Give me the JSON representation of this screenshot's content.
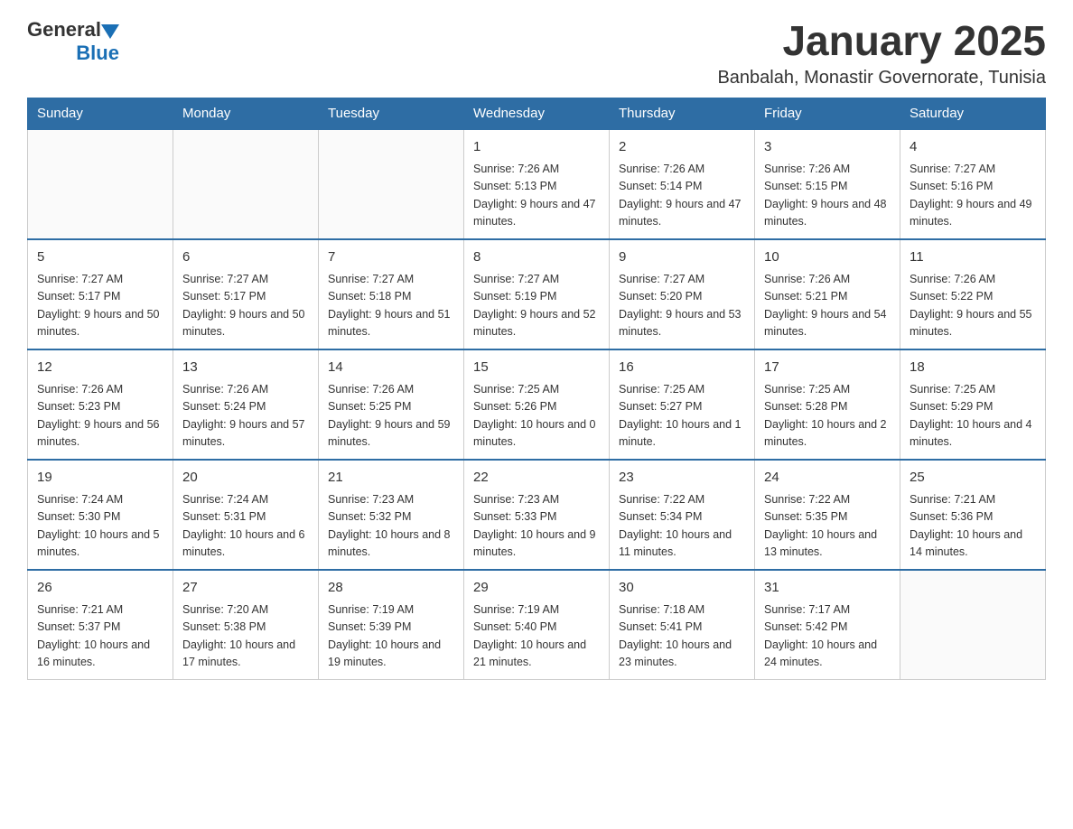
{
  "header": {
    "logo_general": "General",
    "logo_blue": "Blue",
    "title": "January 2025",
    "subtitle": "Banbalah, Monastir Governorate, Tunisia"
  },
  "days_of_week": [
    "Sunday",
    "Monday",
    "Tuesday",
    "Wednesday",
    "Thursday",
    "Friday",
    "Saturday"
  ],
  "weeks": [
    [
      {
        "day": "",
        "info": ""
      },
      {
        "day": "",
        "info": ""
      },
      {
        "day": "",
        "info": ""
      },
      {
        "day": "1",
        "info": "Sunrise: 7:26 AM\nSunset: 5:13 PM\nDaylight: 9 hours and 47 minutes."
      },
      {
        "day": "2",
        "info": "Sunrise: 7:26 AM\nSunset: 5:14 PM\nDaylight: 9 hours and 47 minutes."
      },
      {
        "day": "3",
        "info": "Sunrise: 7:26 AM\nSunset: 5:15 PM\nDaylight: 9 hours and 48 minutes."
      },
      {
        "day": "4",
        "info": "Sunrise: 7:27 AM\nSunset: 5:16 PM\nDaylight: 9 hours and 49 minutes."
      }
    ],
    [
      {
        "day": "5",
        "info": "Sunrise: 7:27 AM\nSunset: 5:17 PM\nDaylight: 9 hours and 50 minutes."
      },
      {
        "day": "6",
        "info": "Sunrise: 7:27 AM\nSunset: 5:17 PM\nDaylight: 9 hours and 50 minutes."
      },
      {
        "day": "7",
        "info": "Sunrise: 7:27 AM\nSunset: 5:18 PM\nDaylight: 9 hours and 51 minutes."
      },
      {
        "day": "8",
        "info": "Sunrise: 7:27 AM\nSunset: 5:19 PM\nDaylight: 9 hours and 52 minutes."
      },
      {
        "day": "9",
        "info": "Sunrise: 7:27 AM\nSunset: 5:20 PM\nDaylight: 9 hours and 53 minutes."
      },
      {
        "day": "10",
        "info": "Sunrise: 7:26 AM\nSunset: 5:21 PM\nDaylight: 9 hours and 54 minutes."
      },
      {
        "day": "11",
        "info": "Sunrise: 7:26 AM\nSunset: 5:22 PM\nDaylight: 9 hours and 55 minutes."
      }
    ],
    [
      {
        "day": "12",
        "info": "Sunrise: 7:26 AM\nSunset: 5:23 PM\nDaylight: 9 hours and 56 minutes."
      },
      {
        "day": "13",
        "info": "Sunrise: 7:26 AM\nSunset: 5:24 PM\nDaylight: 9 hours and 57 minutes."
      },
      {
        "day": "14",
        "info": "Sunrise: 7:26 AM\nSunset: 5:25 PM\nDaylight: 9 hours and 59 minutes."
      },
      {
        "day": "15",
        "info": "Sunrise: 7:25 AM\nSunset: 5:26 PM\nDaylight: 10 hours and 0 minutes."
      },
      {
        "day": "16",
        "info": "Sunrise: 7:25 AM\nSunset: 5:27 PM\nDaylight: 10 hours and 1 minute."
      },
      {
        "day": "17",
        "info": "Sunrise: 7:25 AM\nSunset: 5:28 PM\nDaylight: 10 hours and 2 minutes."
      },
      {
        "day": "18",
        "info": "Sunrise: 7:25 AM\nSunset: 5:29 PM\nDaylight: 10 hours and 4 minutes."
      }
    ],
    [
      {
        "day": "19",
        "info": "Sunrise: 7:24 AM\nSunset: 5:30 PM\nDaylight: 10 hours and 5 minutes."
      },
      {
        "day": "20",
        "info": "Sunrise: 7:24 AM\nSunset: 5:31 PM\nDaylight: 10 hours and 6 minutes."
      },
      {
        "day": "21",
        "info": "Sunrise: 7:23 AM\nSunset: 5:32 PM\nDaylight: 10 hours and 8 minutes."
      },
      {
        "day": "22",
        "info": "Sunrise: 7:23 AM\nSunset: 5:33 PM\nDaylight: 10 hours and 9 minutes."
      },
      {
        "day": "23",
        "info": "Sunrise: 7:22 AM\nSunset: 5:34 PM\nDaylight: 10 hours and 11 minutes."
      },
      {
        "day": "24",
        "info": "Sunrise: 7:22 AM\nSunset: 5:35 PM\nDaylight: 10 hours and 13 minutes."
      },
      {
        "day": "25",
        "info": "Sunrise: 7:21 AM\nSunset: 5:36 PM\nDaylight: 10 hours and 14 minutes."
      }
    ],
    [
      {
        "day": "26",
        "info": "Sunrise: 7:21 AM\nSunset: 5:37 PM\nDaylight: 10 hours and 16 minutes."
      },
      {
        "day": "27",
        "info": "Sunrise: 7:20 AM\nSunset: 5:38 PM\nDaylight: 10 hours and 17 minutes."
      },
      {
        "day": "28",
        "info": "Sunrise: 7:19 AM\nSunset: 5:39 PM\nDaylight: 10 hours and 19 minutes."
      },
      {
        "day": "29",
        "info": "Sunrise: 7:19 AM\nSunset: 5:40 PM\nDaylight: 10 hours and 21 minutes."
      },
      {
        "day": "30",
        "info": "Sunrise: 7:18 AM\nSunset: 5:41 PM\nDaylight: 10 hours and 23 minutes."
      },
      {
        "day": "31",
        "info": "Sunrise: 7:17 AM\nSunset: 5:42 PM\nDaylight: 10 hours and 24 minutes."
      },
      {
        "day": "",
        "info": ""
      }
    ]
  ]
}
